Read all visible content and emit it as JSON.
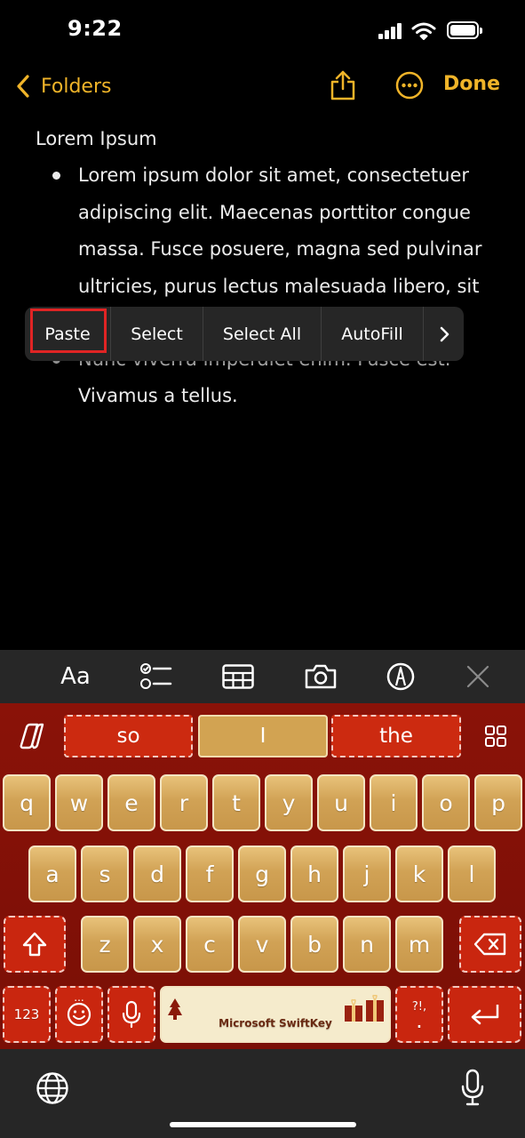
{
  "status": {
    "time": "9:22"
  },
  "nav": {
    "back_label": "Folders",
    "done_label": "Done",
    "share_icon": "share-icon",
    "more_icon": "more-icon"
  },
  "note": {
    "title": "Lorem Ipsum",
    "bullet1": "Lorem ipsum dolor sit amet, consectetuer adipiscing elit. Maecenas porttitor congue massa. Fusce posuere, magna sed pulvinar ultricies, purus lectus malesuada libero, sit",
    "bullet2_line1": "Nunc viverra imperdiet enim. Fusce est.",
    "bullet2_line2": "Vivamus a tellus."
  },
  "context_menu": {
    "items": [
      "Paste",
      "Select",
      "Select All",
      "AutoFill"
    ],
    "more_icon": "chevron-right-icon",
    "highlight_color": "#e02424"
  },
  "format_bar": {
    "text_style_label": "Aa",
    "icons": [
      "checklist-icon",
      "table-icon",
      "camera-icon",
      "markup-icon",
      "close-icon"
    ]
  },
  "keyboard": {
    "suggestions": [
      "so",
      "I",
      "the"
    ],
    "row1": [
      "q",
      "w",
      "e",
      "r",
      "t",
      "y",
      "u",
      "i",
      "o",
      "p"
    ],
    "row2": [
      "a",
      "s",
      "d",
      "f",
      "g",
      "h",
      "j",
      "k",
      "l"
    ],
    "row3": [
      "z",
      "x",
      "c",
      "v",
      "b",
      "n",
      "m"
    ],
    "numbers_label": "123",
    "punct_label": "?!,",
    "punct_dot": ".",
    "space_label": "Microsoft SwiftKey",
    "emoji_dots": "...",
    "colors": {
      "gold": "#d1a255",
      "red": "#c9260f",
      "background": "#7a0f06"
    }
  },
  "bottom": {
    "icons": [
      "globe-icon",
      "microphone-icon"
    ]
  },
  "accent": "#f0b429"
}
